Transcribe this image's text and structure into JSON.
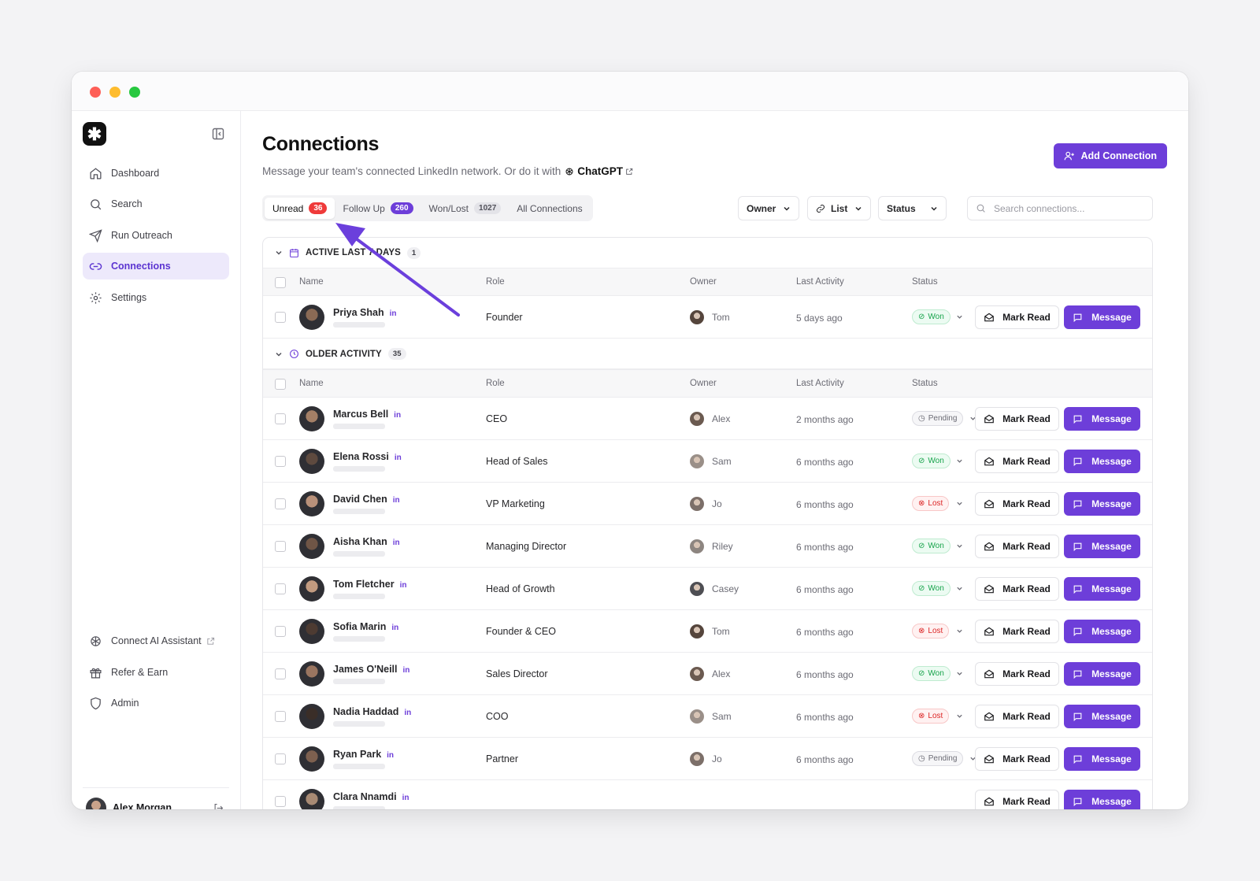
{
  "sidebar": {
    "nav": [
      {
        "label": "Dashboard",
        "icon": "home-icon"
      },
      {
        "label": "Search",
        "icon": "search-icon"
      },
      {
        "label": "Run Outreach",
        "icon": "send-icon"
      },
      {
        "label": "Connections",
        "icon": "link-icon",
        "active": true
      },
      {
        "label": "Settings",
        "icon": "gear-icon"
      }
    ],
    "bottom_nav": [
      {
        "label": "Connect AI Assistant",
        "icon": "openai-icon"
      },
      {
        "label": "Refer & Earn",
        "icon": "gift-icon"
      },
      {
        "label": "Admin",
        "icon": "shield-icon"
      }
    ],
    "user_name": "Alex Morgan"
  },
  "header": {
    "title": "Connections",
    "subtitle": "Message your team's connected LinkedIn network. Or do it with",
    "subtitle_link": "ChatGPT",
    "add_button": "Add Connection"
  },
  "tabs": [
    {
      "label": "Unread",
      "count": "36"
    },
    {
      "label": "Follow Up",
      "count": "260"
    },
    {
      "label": "Won/Lost",
      "count": "1027"
    },
    {
      "label": "All Connections",
      "count": ""
    }
  ],
  "filters": {
    "owner": "Owner",
    "list": "List",
    "status": "Status",
    "search_placeholder": "Search connections..."
  },
  "columns": {
    "name": "Name",
    "role": "Role",
    "owner": "Owner",
    "last_activity": "Last Activity",
    "status": "Status"
  },
  "groups": {
    "active": {
      "label": "Active last 7 days",
      "count": "1"
    },
    "older": {
      "label": "Older activity",
      "count": "35"
    }
  },
  "buttons": {
    "mark_read": "Mark Read",
    "message": "Message",
    "linkedin": "in"
  },
  "active_rows": [
    {
      "name": "Priya Shah",
      "role": "Founder",
      "owner": "Tom",
      "activity": "5 days ago",
      "status": "Won"
    }
  ],
  "older_rows": [
    {
      "name": "Marcus Bell",
      "role": "CEO",
      "owner": "Alex",
      "activity": "2 months ago",
      "status": "Pending"
    },
    {
      "name": "Elena Rossi",
      "role": "Head of Sales",
      "owner": "Sam",
      "activity": "6 months ago",
      "status": "Won"
    },
    {
      "name": "David Chen",
      "role": "VP Marketing",
      "owner": "Jo",
      "activity": "6 months ago",
      "status": "Lost"
    },
    {
      "name": "Aisha Khan",
      "role": "Managing Director",
      "owner": "Riley",
      "activity": "6 months ago",
      "status": "Won"
    },
    {
      "name": "Tom Fletcher",
      "role": "Head of Growth",
      "owner": "Casey",
      "activity": "6 months ago",
      "status": "Won"
    },
    {
      "name": "Sofia Marin",
      "role": "Founder & CEO",
      "owner": "Tom",
      "activity": "6 months ago",
      "status": "Lost"
    },
    {
      "name": "James O'Neill",
      "role": "Sales Director",
      "owner": "Alex",
      "activity": "6 months ago",
      "status": "Won"
    },
    {
      "name": "Nadia Haddad",
      "role": "COO",
      "owner": "Sam",
      "activity": "6 months ago",
      "status": "Lost"
    },
    {
      "name": "Ryan Park",
      "role": "Partner",
      "owner": "Jo",
      "activity": "6 months ago",
      "status": "Pending"
    },
    {
      "name": "Clara Nnamdi",
      "role": "",
      "owner": "",
      "activity": "",
      "status": ""
    }
  ],
  "colors": {
    "accent": "#6d3ed9",
    "won": "#16a34a",
    "lost": "#dc2626",
    "badge_red": "#ef3a3a"
  }
}
